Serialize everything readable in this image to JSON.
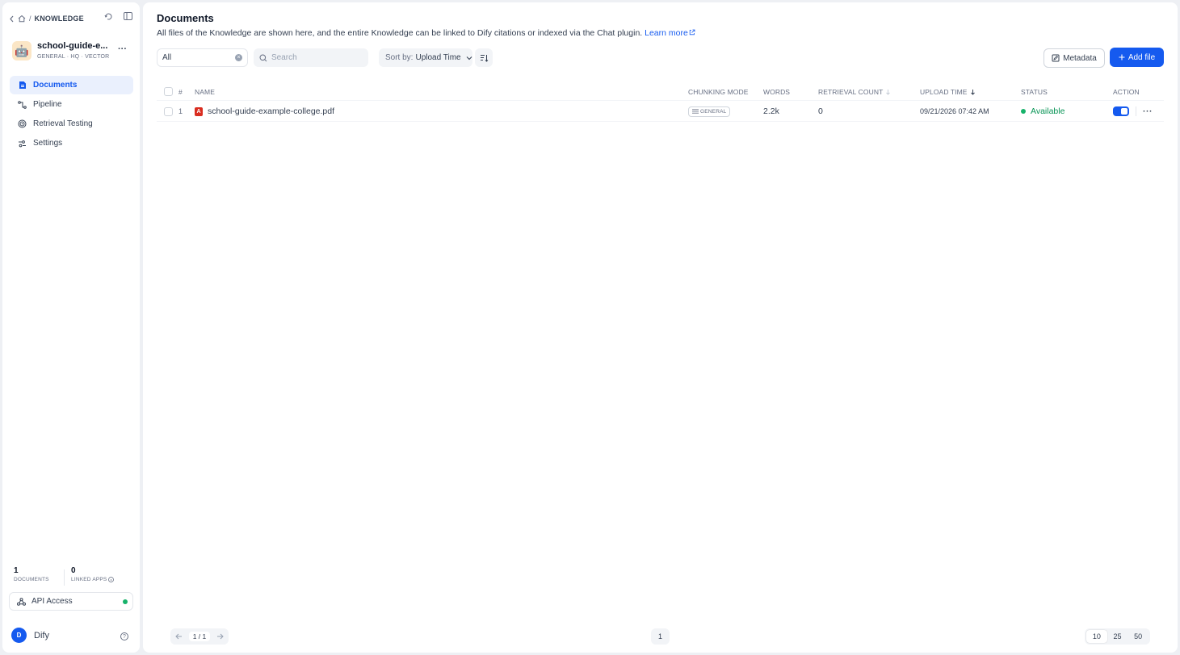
{
  "breadcrumb": {
    "section": "KNOWLEDGE"
  },
  "dataset": {
    "name": "school-guide-e...",
    "meta": "GENERAL · HQ · VECTOR",
    "avatar_emoji": "🤖"
  },
  "sidebar": {
    "items": [
      {
        "label": "Documents",
        "icon": "document-icon",
        "active": true
      },
      {
        "label": "Pipeline",
        "icon": "pipeline-icon",
        "active": false
      },
      {
        "label": "Retrieval Testing",
        "icon": "target-icon",
        "active": false
      },
      {
        "label": "Settings",
        "icon": "settings-icon",
        "active": false
      }
    ],
    "stats": {
      "documents_value": "1",
      "documents_label": "DOCUMENTS",
      "linked_apps_value": "0",
      "linked_apps_label": "LINKED APPS"
    },
    "api_access": "API Access",
    "user": {
      "initial": "D",
      "name": "Dify"
    }
  },
  "main": {
    "title": "Documents",
    "description": "All files of the Knowledge are shown here, and the entire Knowledge can be linked to Dify citations or indexed via the Chat plugin.",
    "learn_more": "Learn more",
    "filter_value": "All",
    "search_placeholder": "Search",
    "sort_prefix": "Sort by:",
    "sort_value": "Upload Time",
    "metadata_button": "Metadata",
    "add_file_button": "Add file"
  },
  "table": {
    "headers": {
      "index": "#",
      "name": "NAME",
      "chunking_mode": "CHUNKING MODE",
      "words": "WORDS",
      "retrieval_count": "RETRIEVAL COUNT",
      "upload_time": "UPLOAD TIME",
      "status": "STATUS",
      "action": "ACTION"
    },
    "rows": [
      {
        "index": "1",
        "name": "school-guide-example-college.pdf",
        "chunking_mode": "GENERAL",
        "words": "2.2k",
        "retrieval_count": "0",
        "upload_time": "09/21/2026 07:42 AM",
        "status": "Available",
        "enabled": true
      }
    ]
  },
  "pagination": {
    "page_indicator": "1 / 1",
    "current_page": "1",
    "limits": [
      "10",
      "25",
      "50"
    ],
    "selected_limit": "10"
  },
  "colors": {
    "accent": "#155aef",
    "status_available": "#17b26a",
    "pdf_red": "#d92d20"
  }
}
